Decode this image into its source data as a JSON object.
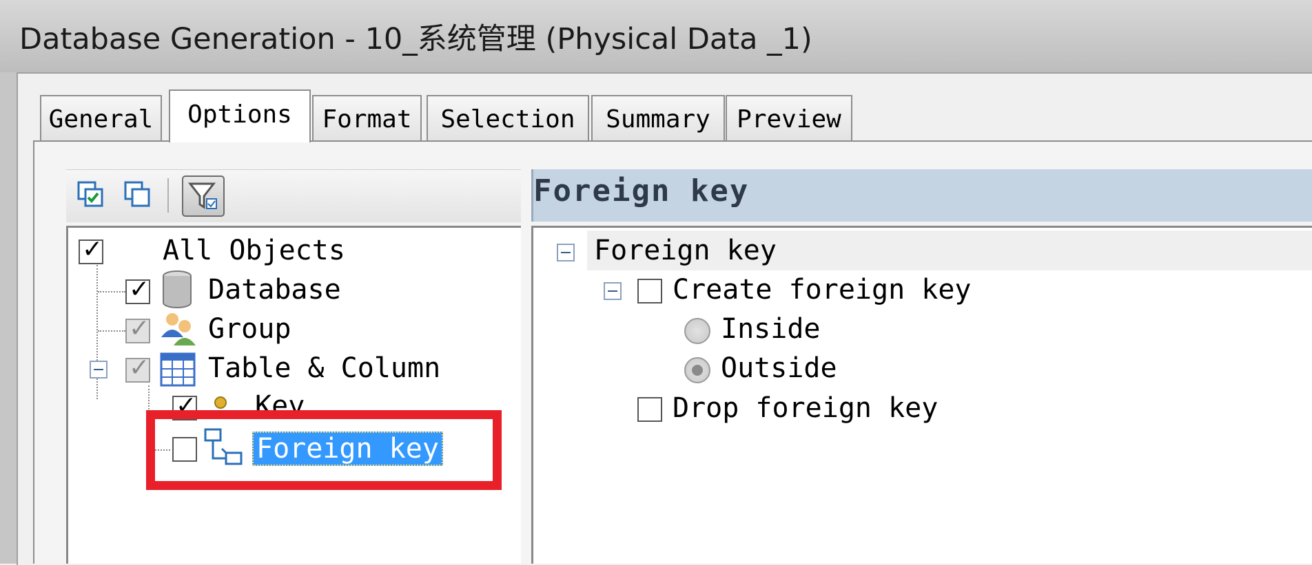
{
  "window": {
    "title": "Database Generation - 10_系统管理 (Physical Data _1)"
  },
  "tabs": [
    {
      "label": "General",
      "active": false
    },
    {
      "label": "Options",
      "active": true
    },
    {
      "label": "Format",
      "active": false
    },
    {
      "label": "Selection",
      "active": false
    },
    {
      "label": "Summary",
      "active": false
    },
    {
      "label": "Preview",
      "active": false
    }
  ],
  "toolbar": {
    "icons": [
      "select-all-icon",
      "deselect-all-icon",
      "filter-icon"
    ]
  },
  "tree": {
    "items": [
      {
        "label": "All Objects",
        "checked": true
      },
      {
        "label": "Database",
        "checked": true,
        "icon": "database-icon"
      },
      {
        "label": "Group",
        "checked": true,
        "icon": "group-icon"
      },
      {
        "label": "Table & Column",
        "checked": true,
        "icon": "table-icon"
      },
      {
        "label": "Key",
        "checked": true,
        "icon": "key-icon"
      },
      {
        "label": "Foreign key",
        "checked": false,
        "selected": true,
        "icon": "foreign-key-icon"
      }
    ]
  },
  "options_panel": {
    "header": "Foreign key",
    "section": "Foreign key",
    "create_fk": {
      "label": "Create foreign key",
      "checked": false
    },
    "radios": [
      {
        "label": "Inside",
        "selected": false
      },
      {
        "label": "Outside",
        "selected": true
      }
    ],
    "drop_fk": {
      "label": "Drop foreign key",
      "checked": false
    }
  },
  "colors": {
    "selection": "#3399ff",
    "highlight_box": "#e8202a",
    "header_bg": "#c5d4e3"
  }
}
